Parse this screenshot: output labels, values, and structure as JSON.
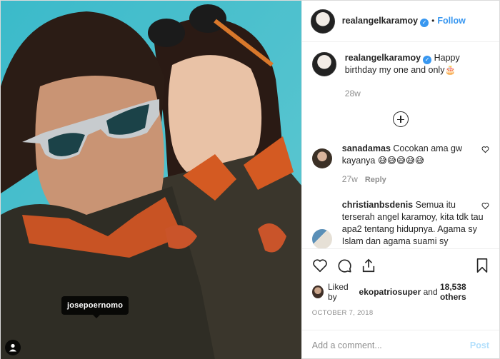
{
  "header": {
    "username": "realangelkaramoy",
    "separator": "•",
    "follow_label": "Follow",
    "verified_icon": "✓"
  },
  "caption": {
    "username": "realangelkaramoy",
    "text": "Happy birthday my one and only🎂",
    "timestamp": "28w"
  },
  "comments": [
    {
      "username": "sanadamas",
      "text": "Cocokan ama gw kayanya 😅😅😅😅😅",
      "timestamp": "27w",
      "reply_label": "Reply"
    },
    {
      "username": "christianbsdenis",
      "text": "Semua itu terserah angel karamoy, kita tdk tau apa2 tentang hidupnya. Agama sy Islam dan agama suami sy Catholic. Alhamdulillah suami sy muallaf dan sdh masuk agama Islam",
      "timestamp": "",
      "reply_label": ""
    }
  ],
  "likes": {
    "prefix": "Liked by",
    "user": "ekopatriosuper",
    "and": "and",
    "count": "18,538 others"
  },
  "date": "OCTOBER 7, 2018",
  "add_comment": {
    "placeholder": "Add a comment...",
    "post_label": "Post"
  },
  "photo": {
    "tag_label": "josepoernomo"
  },
  "colors": {
    "accent": "#3897f0",
    "post_disabled": "#b2dffc",
    "muted": "#8e8e8e"
  },
  "icons": [
    "heart-icon",
    "comment-icon",
    "share-icon",
    "bookmark-icon",
    "plus-circle-icon",
    "user-tag-icon",
    "verified-icon"
  ]
}
